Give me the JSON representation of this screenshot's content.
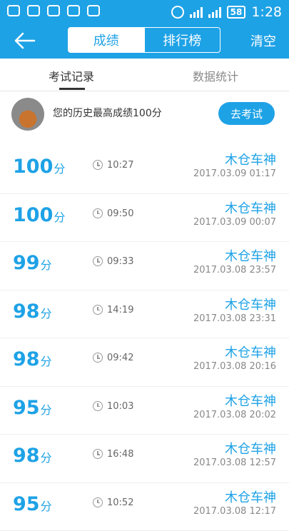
{
  "status_bar": {
    "battery": "58",
    "time": "1:28"
  },
  "header": {
    "tabs": [
      "成绩",
      "排行榜"
    ],
    "clear": "清空"
  },
  "sub_tabs": [
    "考试记录",
    "数据统计"
  ],
  "best": {
    "text": "您的历史最高成绩100分",
    "button": "去考试"
  },
  "records": [
    {
      "score": "100",
      "unit": "分",
      "duration": "10:27",
      "name": "木仓车神",
      "date": "2017.03.09  01:17"
    },
    {
      "score": "100",
      "unit": "分",
      "duration": "09:50",
      "name": "木仓车神",
      "date": "2017.03.09  00:07"
    },
    {
      "score": "99",
      "unit": "分",
      "duration": "09:33",
      "name": "木仓车神",
      "date": "2017.03.08  23:57"
    },
    {
      "score": "98",
      "unit": "分",
      "duration": "14:19",
      "name": "木仓车神",
      "date": "2017.03.08  23:31"
    },
    {
      "score": "98",
      "unit": "分",
      "duration": "09:42",
      "name": "木仓车神",
      "date": "2017.03.08  20:16"
    },
    {
      "score": "95",
      "unit": "分",
      "duration": "10:03",
      "name": "木仓车神",
      "date": "2017.03.08  20:02"
    },
    {
      "score": "98",
      "unit": "分",
      "duration": "16:48",
      "name": "木仓车神",
      "date": "2017.03.08  12:57"
    },
    {
      "score": "95",
      "unit": "分",
      "duration": "10:52",
      "name": "木仓车神",
      "date": "2017.03.08  12:17"
    }
  ]
}
